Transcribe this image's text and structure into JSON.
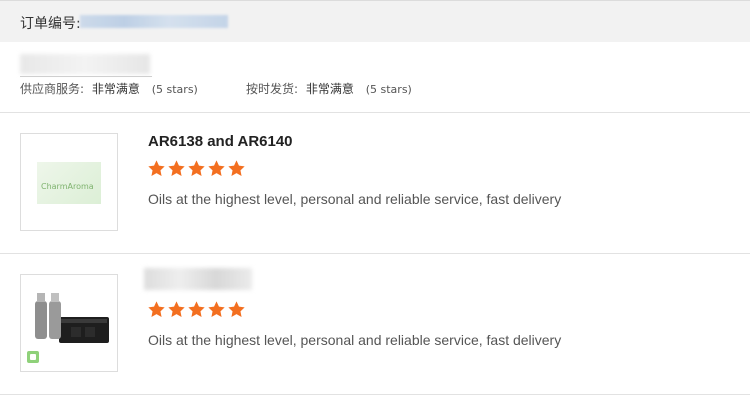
{
  "order": {
    "label": "订单编号:"
  },
  "ratings": [
    {
      "label": "供应商服务:",
      "value": "非常满意",
      "stars_text": "(5 stars)"
    },
    {
      "label": "按时发货:",
      "value": "非常满意",
      "stars_text": "(5 stars)"
    }
  ],
  "products": [
    {
      "title": "AR6138 and AR6140",
      "thumb_logo_text": "CharmAroma",
      "rating": 5,
      "review": "Oils at the highest level, personal and reliable service, fast delivery"
    },
    {
      "title": "",
      "rating": 5,
      "review": "Oils at the highest level, personal and reliable service, fast delivery"
    }
  ],
  "colors": {
    "star": "#f36f20",
    "header_bg": "#f2f2f2",
    "divider": "#e2e2e2"
  },
  "icons": {
    "star": "star-icon",
    "machine": "aroma-diffuser-machine-icon",
    "logo": "brand-logo-image"
  }
}
